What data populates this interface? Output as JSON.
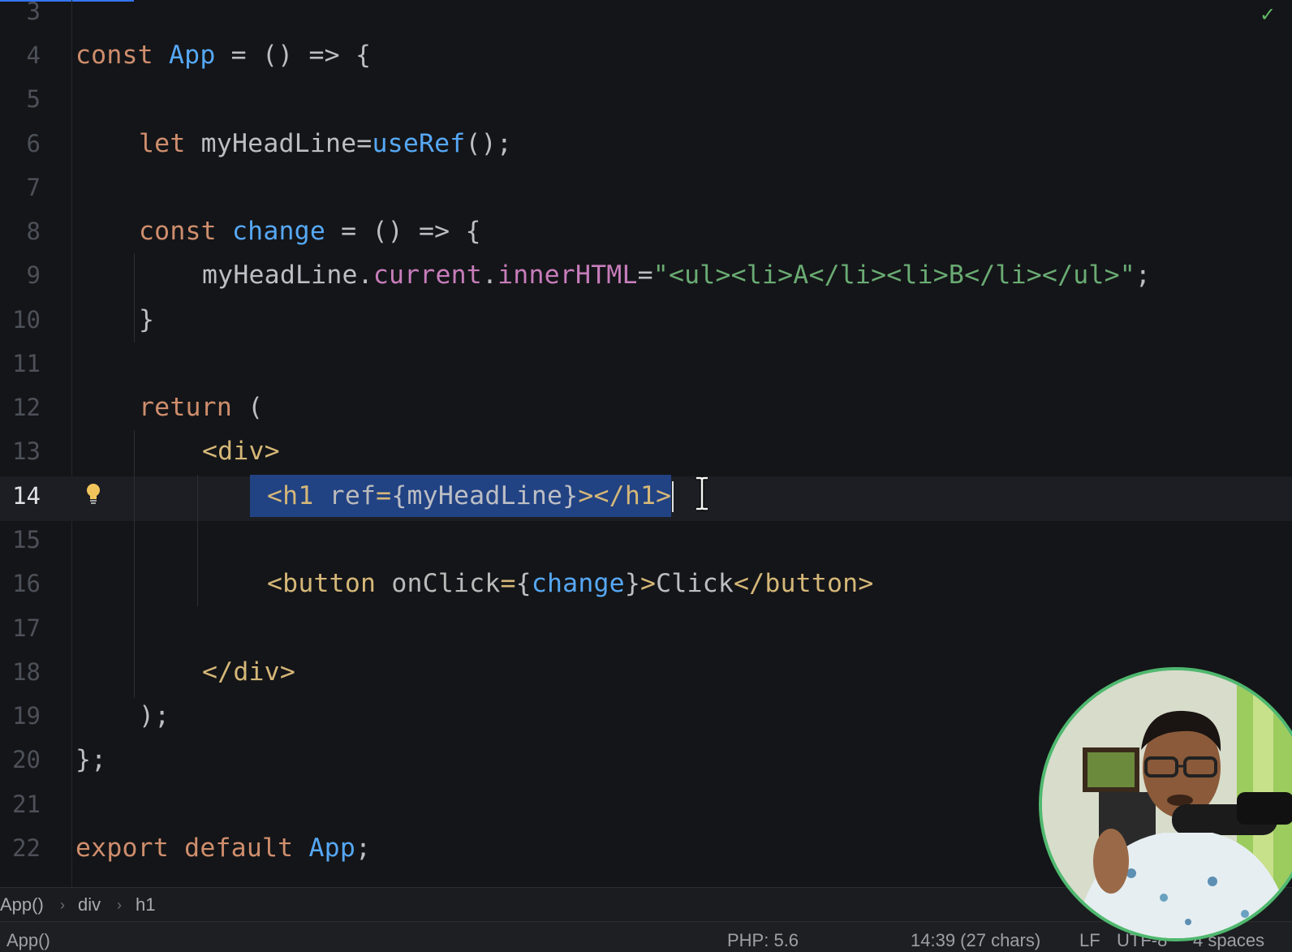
{
  "editor": {
    "status_icon": "check-icon",
    "lines": [
      {
        "n": "3"
      },
      {
        "n": "4"
      },
      {
        "n": "5"
      },
      {
        "n": "6"
      },
      {
        "n": "7"
      },
      {
        "n": "8"
      },
      {
        "n": "9"
      },
      {
        "n": "10"
      },
      {
        "n": "11"
      },
      {
        "n": "12"
      },
      {
        "n": "13"
      },
      {
        "n": "14"
      },
      {
        "n": "15"
      },
      {
        "n": "16"
      },
      {
        "n": "17"
      },
      {
        "n": "18"
      },
      {
        "n": "19"
      },
      {
        "n": "20"
      },
      {
        "n": "21"
      },
      {
        "n": "22"
      }
    ],
    "tokens": {
      "l4_const": "const",
      "l4_app": "App",
      "l4_rest": " = () => {",
      "l6_let": "let",
      "l6_var": " myHeadLine=",
      "l6_fn": "useRef",
      "l6_rest": "();",
      "l8_const": "const",
      "l8_fn": "change",
      "l8_rest": " = () => {",
      "l9_obj": "myHeadLine.",
      "l9_current": "current",
      "l9_dot": ".",
      "l9_inner": "innerHTML",
      "l9_eq": "=",
      "l9_str": "\"<ul><li>A</li><li>B</li></ul>\"",
      "l9_end": ";",
      "l10": "}",
      "l12_return": "return",
      "l12_rest": " (",
      "l13_tag": "<div>",
      "l14_open": "<h1 ",
      "l14_attr": "ref",
      "l14_eq": "=",
      "l14_val": "{myHeadLine}",
      "l14_close": "></h1>",
      "l16_open": "<button ",
      "l16_attr": "onClick",
      "l16_eq": "=",
      "l16_lb": "{",
      "l16_fn": "change",
      "l16_rb": "}",
      "l16_gt": ">",
      "l16_text": "Click",
      "l16_close": "</button>",
      "l18_tag": "</div>",
      "l19": ");",
      "l20": "};",
      "l22_export": "export",
      "l22_default": "default",
      "l22_app": "App",
      "l22_end": ";"
    }
  },
  "breadcrumb": {
    "items": [
      "App()",
      "div",
      "h1"
    ],
    "sep": "›"
  },
  "statusbar": {
    "left": "App()",
    "php": "PHP: 5.6",
    "position": "14:39 (27 chars)",
    "line_ending": "LF",
    "encoding": "UTF-8",
    "indent": "4 spaces"
  },
  "colors": {
    "background": "#141518",
    "keyword": "#cf8e6d",
    "function": "#56a8f5",
    "property": "#c77dbb",
    "string": "#6aab73",
    "tag": "#d5b778",
    "selection": "#214283",
    "webcam_border": "#4fb86f"
  }
}
